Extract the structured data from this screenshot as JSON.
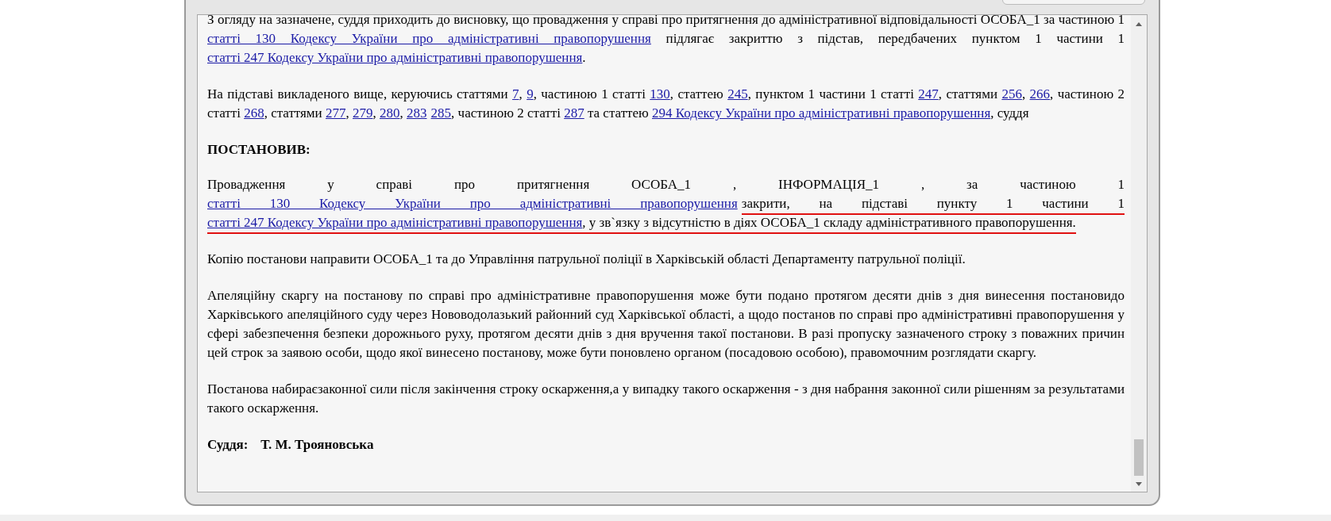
{
  "paragraphs": [
    {
      "kind": "text",
      "segments": [
        {
          "text": "З огляду на зазначене, суддя приходить до висновку, що провадження у справі про притягнення до адміністративної відповідальності ОСОБА_1 за частиною 1 ",
          "link": false
        },
        {
          "text": "статті 130 Кодексу України про адміністративні правопорушення",
          "link": true
        },
        {
          "text": " підлягає закриттю з підстав, передбачених пунктом 1 частини 1 ",
          "link": false
        },
        {
          "text": "статті 247 Кодексу України про адміністративні правопорушення",
          "link": true
        },
        {
          "text": ".",
          "link": false
        }
      ]
    },
    {
      "kind": "text",
      "segments": [
        {
          "text": "На підставі викладеного вище, керуючись статтями ",
          "link": false
        },
        {
          "text": "7",
          "link": true
        },
        {
          "text": ", ",
          "link": false
        },
        {
          "text": "9",
          "link": true
        },
        {
          "text": ", частиною 1 статті ",
          "link": false
        },
        {
          "text": "130",
          "link": true
        },
        {
          "text": ", статтею ",
          "link": false
        },
        {
          "text": "245",
          "link": true
        },
        {
          "text": ", пунктом 1 частини 1 статті ",
          "link": false
        },
        {
          "text": "247",
          "link": true
        },
        {
          "text": ", статтями ",
          "link": false
        },
        {
          "text": "256",
          "link": true
        },
        {
          "text": ", ",
          "link": false
        },
        {
          "text": "266",
          "link": true
        },
        {
          "text": ", частиною 2 статті ",
          "link": false
        },
        {
          "text": "268",
          "link": true
        },
        {
          "text": ", статтями ",
          "link": false
        },
        {
          "text": "277",
          "link": true
        },
        {
          "text": ", ",
          "link": false
        },
        {
          "text": "279",
          "link": true
        },
        {
          "text": ", ",
          "link": false
        },
        {
          "text": "280",
          "link": true
        },
        {
          "text": ", ",
          "link": false
        },
        {
          "text": "283",
          "link": true,
          "gap_after": true
        },
        {
          "text": "285",
          "link": true
        },
        {
          "text": ", частиною 2 статті ",
          "link": false
        },
        {
          "text": "287",
          "link": true
        },
        {
          "text": " та статтею ",
          "link": false
        },
        {
          "text": "294 Кодексу України про адміністративні правопорушення",
          "link": true
        },
        {
          "text": ", суддя",
          "link": false
        }
      ]
    },
    {
      "kind": "heading",
      "segments": [
        {
          "text": "ПОСТАНОВИВ:",
          "link": false
        }
      ]
    },
    {
      "kind": "text",
      "segments": [
        {
          "text": "Провадження у справі про притягнення ОСОБА_1 , ІНФОРМАЦІЯ_1 , за частиною 1 ",
          "link": false,
          "marked": false
        },
        {
          "text": "статті 130 Кодексу України про адміністративні правопорушення",
          "link": true,
          "marked": false,
          "gap_after": true
        },
        {
          "text": "закрити, на підставі пункту 1 частини 1 ",
          "link": false,
          "marked": true
        },
        {
          "text": "статті 247 Кодексу України про адміністративні правопорушення",
          "link": true,
          "marked": true
        },
        {
          "text": ", у зв`язку з відсутністю в діях ОСОБА_1 складу адміністративного правопорушення.",
          "link": false,
          "marked": true
        }
      ]
    },
    {
      "kind": "text",
      "segments": [
        {
          "text": "Копію постанови направити ОСОБА_1 та до Управління патрульної поліції в Харківській області Департаменту патрульної поліції.",
          "link": false
        }
      ]
    },
    {
      "kind": "text",
      "segments": [
        {
          "text": "Апеляційну скаргу на постанову по справі про адміністративне правопорушення може бути подано протягом десяти днів з дня винесення постановидо Харківського апеляційного суду через Нововодолазький районний суд Харківської області, а щодо постанов по справі про адміністративні правопорушення у сфері забезпечення безпеки дорожнього руху, протягом десяти днів з дня вручення такої постанови. В разі пропуску зазначеного строку з поважних причин цей строк за заявою особи, щодо якої винесено постанову, може бути поновлено органом (посадовою особою), правомочним розглядати скаргу.",
          "link": false
        }
      ]
    },
    {
      "kind": "text",
      "segments": [
        {
          "text": "Постанова набираєзаконної сили після закінчення строку оскарження,а у випадку такого оскарження - з дня набрання законної сили рішенням за результатами такого оскарження.",
          "link": false
        }
      ]
    },
    {
      "kind": "signature",
      "label": "Суддя:",
      "name": "Т. М. Трояновська"
    }
  ]
}
